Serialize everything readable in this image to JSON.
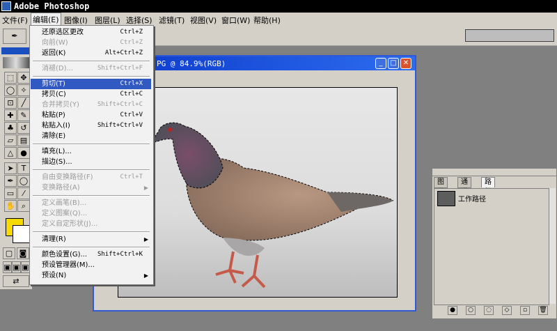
{
  "app": {
    "title": "Adobe Photoshop"
  },
  "menubar": [
    {
      "label": "文件(F)"
    },
    {
      "label": "编辑(E)"
    },
    {
      "label": "图像(I)"
    },
    {
      "label": "图层(L)"
    },
    {
      "label": "选择(S)"
    },
    {
      "label": "滤镜(T)"
    },
    {
      "label": "视图(V)"
    },
    {
      "label": "窗口(W)"
    },
    {
      "label": "帮助(H)"
    }
  ],
  "document": {
    "title": "PG @ 84.9%(RGB)"
  },
  "edit_menu": {
    "items": [
      {
        "label": "还原选区更改",
        "shortcut": "Ctrl+Z"
      },
      {
        "label": "向前(W)",
        "shortcut": "Ctrl+Z"
      },
      {
        "label": "返回(K)",
        "shortcut": "Alt+Ctrl+Z"
      },
      {
        "label": "消褪(D)...",
        "shortcut": "Shift+Ctrl+F"
      },
      {
        "label": "剪切(T)",
        "shortcut": "Ctrl+X"
      },
      {
        "label": "拷贝(C)",
        "shortcut": "Ctrl+C"
      },
      {
        "label": "合并拷贝(Y)",
        "shortcut": "Shift+Ctrl+C"
      },
      {
        "label": "粘贴(P)",
        "shortcut": "Ctrl+V"
      },
      {
        "label": "粘贴入(I)",
        "shortcut": "Shift+Ctrl+V"
      },
      {
        "label": "清除(E)",
        "shortcut": ""
      },
      {
        "label": "填充(L)...",
        "shortcut": ""
      },
      {
        "label": "描边(S)...",
        "shortcut": ""
      },
      {
        "label": "自由变换路径(F)",
        "shortcut": "Ctrl+T"
      },
      {
        "label": "变换路径(A)",
        "shortcut": ""
      },
      {
        "label": "定义画笔(B)...",
        "shortcut": ""
      },
      {
        "label": "定义图案(Q)...",
        "shortcut": ""
      },
      {
        "label": "定义自定形状(J)...",
        "shortcut": ""
      },
      {
        "label": "清理(R)",
        "shortcut": ""
      },
      {
        "label": "颜色设置(G)...",
        "shortcut": "Shift+Ctrl+K"
      },
      {
        "label": "预设管理器(M)...",
        "shortcut": ""
      },
      {
        "label": "预设(N)",
        "shortcut": ""
      }
    ]
  },
  "paths_panel": {
    "tabs": [
      {
        "label": "图层"
      },
      {
        "label": "通道"
      },
      {
        "label": "路径"
      }
    ],
    "path_name": "工作路径"
  },
  "colors": {
    "foreground": "#f6d900",
    "background": "#ffffff",
    "title_blue": "#0a36c8",
    "menu_highlight": "#3159c2"
  },
  "icons": [
    "app-icon",
    "minimize-icon",
    "maximize-icon",
    "close-icon",
    "submenu-arrow-icon",
    "pigeon-image"
  ]
}
